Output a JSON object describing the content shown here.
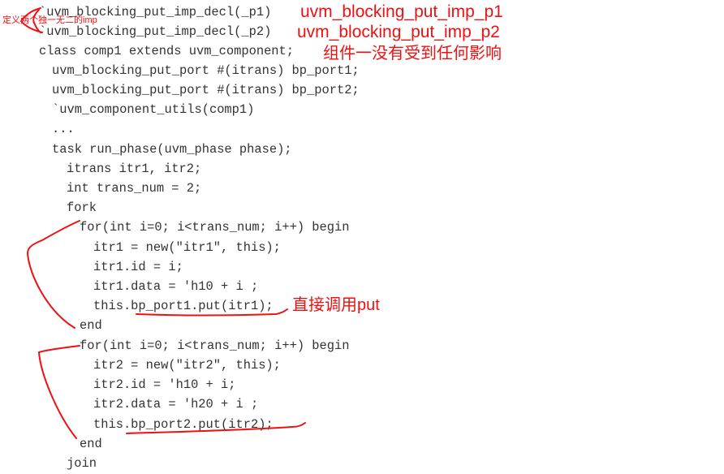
{
  "code": {
    "lines": [
      "`uvm_blocking_put_imp_decl(_p1)",
      "`uvm_blocking_put_imp_decl(_p2)",
      "class comp1 extends uvm_component;",
      "uvm_blocking_put_port #(itrans) bp_port1;",
      "uvm_blocking_put_port #(itrans) bp_port2;",
      "`uvm_component_utils(comp1)",
      "...",
      "task run_phase(uvm_phase phase);",
      "itrans itr1, itr2;",
      "int trans_num = 2;",
      "fork",
      "for(int i=0; i<trans_num; i++) begin",
      "itr1 = new(\"itr1\", this);",
      "itr1.id = i;",
      "itr1.data = 'h10 + i ;",
      "this.bp_port1.put(itr1);",
      "end",
      "for(int i=0; i<trans_num; i++) begin",
      "itr2 = new(\"itr2\", this);",
      "itr2.id = 'h10 + i;",
      "itr2.data = 'h20 + i ;",
      "this.bp_port2.put(itr2);",
      "end",
      "join"
    ]
  },
  "annotations": {
    "imp_p1": "uvm_blocking_put_imp_p1",
    "imp_p2": "uvm_blocking_put_imp_p2",
    "component_note": "组件一没有受到任何影响",
    "define_note": "定义两个独一无二的imp",
    "put_note": "直接调用put"
  },
  "colors": {
    "code_text": "#333333",
    "annotation_red": "#ee1111",
    "background": "#ffffff"
  }
}
